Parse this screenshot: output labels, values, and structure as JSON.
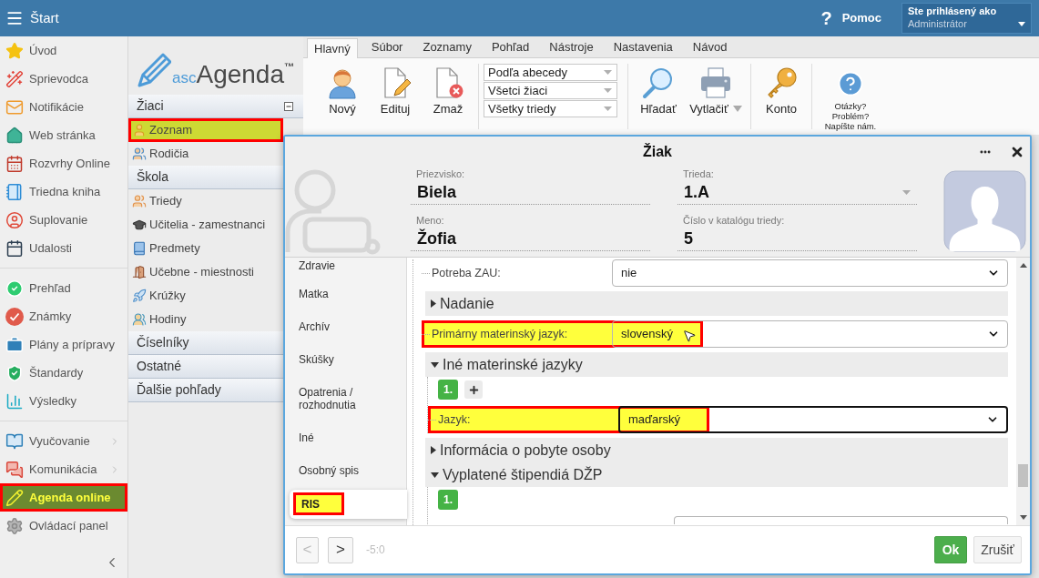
{
  "top_bar": {
    "title": "Štart",
    "help": {
      "icon": "?",
      "label": "Pomoc"
    },
    "user": {
      "caption": "Ste prihlásený ako",
      "name": "Administrátor"
    }
  },
  "sidebar": {
    "groups": [
      {
        "items": [
          {
            "label": "Úvod",
            "selected": false,
            "highlighted": false,
            "submenu": false
          },
          {
            "label": "Sprievodca",
            "selected": false,
            "highlighted": false,
            "submenu": false
          },
          {
            "label": "Notifikácie",
            "selected": false,
            "highlighted": false,
            "submenu": false
          },
          {
            "label": "Web stránka",
            "selected": false,
            "highlighted": false,
            "submenu": false
          },
          {
            "label": "Rozvrhy Online",
            "selected": false,
            "highlighted": false,
            "submenu": false
          },
          {
            "label": "Triedna kniha",
            "selected": false,
            "highlighted": false,
            "submenu": false
          },
          {
            "label": "Suplovanie",
            "selected": false,
            "highlighted": false,
            "submenu": false
          },
          {
            "label": "Udalosti",
            "selected": false,
            "highlighted": false,
            "submenu": false
          }
        ]
      },
      {
        "items": [
          {
            "label": "Prehľad",
            "selected": false,
            "highlighted": false,
            "submenu": false
          },
          {
            "label": "Známky",
            "selected": false,
            "highlighted": false,
            "submenu": false
          },
          {
            "label": "Plány a prípravy",
            "selected": false,
            "highlighted": false,
            "submenu": false
          },
          {
            "label": "Štandardy",
            "selected": false,
            "highlighted": false,
            "submenu": false
          },
          {
            "label": "Výsledky",
            "selected": false,
            "highlighted": false,
            "submenu": false
          }
        ]
      },
      {
        "items": [
          {
            "label": "Vyučovanie",
            "selected": false,
            "highlighted": false,
            "submenu": true
          },
          {
            "label": "Komunikácia",
            "selected": false,
            "highlighted": false,
            "submenu": true
          },
          {
            "label": "Agenda online",
            "selected": true,
            "highlighted": true,
            "submenu": false
          },
          {
            "label": "Ovládací panel",
            "selected": false,
            "highlighted": false,
            "submenu": false
          }
        ]
      }
    ]
  },
  "navigator": {
    "logo": {
      "prefix": "asc",
      "name": "Agenda",
      "mark": "™"
    },
    "groups": [
      {
        "label": "Žiaci",
        "collapse_button": true,
        "children": [
          {
            "label": "Zoznam",
            "selected": true,
            "highlighted": true
          },
          {
            "label": "Rodičia",
            "selected": false,
            "highlighted": false
          }
        ]
      },
      {
        "label": "Škola",
        "collapse_button": false,
        "children": [
          {
            "label": "Triedy",
            "selected": false,
            "highlighted": false
          },
          {
            "label": "Učitelia - zamestnanci",
            "selected": false,
            "highlighted": false
          },
          {
            "label": "Predmety",
            "selected": false,
            "highlighted": false
          },
          {
            "label": "Učebne - miestnosti",
            "selected": false,
            "highlighted": false
          },
          {
            "label": "Krúžky",
            "selected": false,
            "highlighted": false
          },
          {
            "label": "Hodiny",
            "selected": false,
            "highlighted": false
          }
        ]
      },
      {
        "label": "Číselníky",
        "collapse_button": false
      },
      {
        "label": "Ostatné",
        "collapse_button": false
      },
      {
        "label": "Ďalšie pohľady",
        "collapse_button": false
      }
    ]
  },
  "ribbon": {
    "tabs": [
      {
        "label": "Hlavný",
        "selected": true
      },
      {
        "label": "Súbor",
        "selected": false
      },
      {
        "label": "Zoznamy",
        "selected": false
      },
      {
        "label": "Pohľad",
        "selected": false
      },
      {
        "label": "Nástroje",
        "selected": false
      },
      {
        "label": "Nastavenia",
        "selected": false
      },
      {
        "label": "Návod",
        "selected": false
      }
    ],
    "groups": [
      {
        "kind": "buttons",
        "buttons": [
          {
            "label": "Nový",
            "menu": false
          },
          {
            "label": "Edituj",
            "menu": false
          },
          {
            "label": "Zmaž",
            "menu": false
          }
        ]
      },
      {
        "kind": "dropdowns",
        "dropdowns": [
          {
            "value": "Podľa abecedy"
          },
          {
            "value": "Všetci žiaci"
          },
          {
            "value": "Všetky triedy"
          }
        ]
      },
      {
        "kind": "buttons",
        "buttons": [
          {
            "label": "Hľadať",
            "menu": false
          },
          {
            "label": "Vytlačiť",
            "menu": true
          }
        ]
      },
      {
        "kind": "buttons",
        "buttons": [
          {
            "label": "Konto",
            "menu": false
          }
        ]
      },
      {
        "kind": "help",
        "lines": [
          "Otázky?",
          "Problém?",
          "Napíšte nám."
        ]
      }
    ]
  },
  "dialog": {
    "title": "Žiak",
    "header_fields": [
      {
        "label": "Priezvisko:",
        "value": "Biela",
        "kind": "text"
      },
      {
        "label": "Trieda:",
        "value": "1.A",
        "kind": "dropdown"
      },
      {
        "label": "Meno:",
        "value": "Žofia",
        "kind": "text"
      },
      {
        "label": "Číslo v katalógu triedy:",
        "value": "5",
        "kind": "text"
      }
    ],
    "tabs": [
      {
        "label": "Zdravie",
        "selected": false,
        "highlighted": false
      },
      {
        "label": "Matka",
        "selected": false,
        "highlighted": false
      },
      {
        "label": "Archív",
        "selected": false,
        "highlighted": false
      },
      {
        "label": "Skúšky",
        "selected": false,
        "highlighted": false
      },
      {
        "label": "Opatrenia / rozhodnutia",
        "selected": false,
        "highlighted": false
      },
      {
        "label": "Iné",
        "selected": false,
        "highlighted": false
      },
      {
        "label": "Osobný spis",
        "selected": false,
        "highlighted": false
      },
      {
        "label": "RIS",
        "selected": true,
        "highlighted": true
      }
    ],
    "form": [
      {
        "kind": "select",
        "label": "Potreba ZAU:",
        "value": "nie",
        "highlighted": false,
        "focused": false,
        "cursor": false
      },
      {
        "kind": "section",
        "label": "Nadanie",
        "expanded": false
      },
      {
        "kind": "select",
        "label": "Primárny materinský jazyk:",
        "value": "slovenský",
        "highlighted": true,
        "focused": false,
        "cursor": true
      },
      {
        "kind": "section",
        "label": "Iné materinské jazyky",
        "expanded": true,
        "children": [
          {
            "kind": "entries",
            "entries": [
              {
                "label": "1."
              }
            ],
            "add_button": true
          },
          {
            "kind": "select",
            "label": "Jazyk:",
            "value": "maďarský",
            "highlighted": true,
            "focused": true,
            "cursor": false
          }
        ]
      },
      {
        "kind": "section",
        "label": "Informácia o pobyte osoby",
        "expanded": false
      },
      {
        "kind": "section",
        "label": "Vyplatené štipendiá DŽP",
        "expanded": true,
        "children": [
          {
            "kind": "entries",
            "entries": [
              {
                "label": "1."
              }
            ],
            "add_button": false
          },
          {
            "kind": "input"
          }
        ]
      }
    ],
    "footer": {
      "previous": {
        "label": "<",
        "disabled": true
      },
      "next": {
        "label": ">",
        "disabled": false
      },
      "position": "-5:0",
      "ok": "Ok",
      "cancel": "Zrušiť"
    }
  }
}
